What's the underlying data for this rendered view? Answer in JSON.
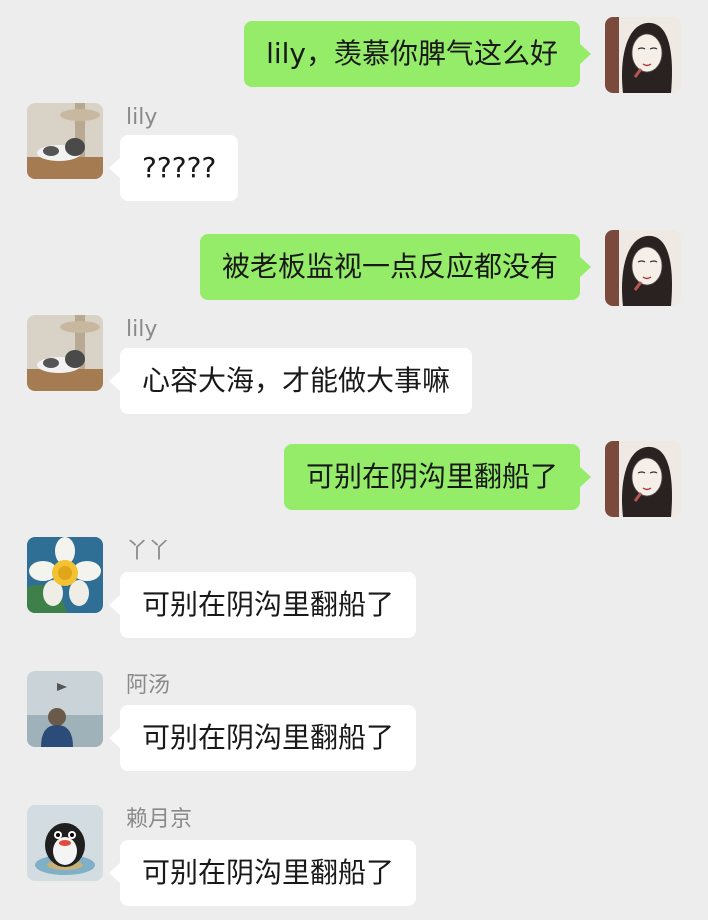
{
  "colors": {
    "background": "#ededed",
    "sent_bubble": "#95ec69",
    "received_bubble": "#ffffff",
    "name_text": "#8a8a8a"
  },
  "messages": [
    {
      "side": "right",
      "avatar": "woman-sketch-avatar",
      "text": "lily，羡慕你脾气这么好"
    },
    {
      "side": "left",
      "sender": "lily",
      "avatar": "cat-avatar",
      "text": "?????"
    },
    {
      "side": "right",
      "avatar": "woman-sketch-avatar",
      "text": "被老板监视一点反应都没有"
    },
    {
      "side": "left",
      "sender": "lily",
      "avatar": "cat-avatar",
      "text": "心容大海，才能做大事嘛"
    },
    {
      "side": "right",
      "avatar": "woman-sketch-avatar",
      "text": "可别在阴沟里翻船了"
    },
    {
      "side": "left",
      "sender": "丫丫",
      "avatar": "daffodil-avatar",
      "text": "可别在阴沟里翻船了"
    },
    {
      "side": "left",
      "sender": "阿汤",
      "avatar": "child-by-sea-avatar",
      "text": "可别在阴沟里翻船了"
    },
    {
      "side": "left",
      "sender": "赖月京",
      "avatar": "penguin-avatar",
      "text": "可别在阴沟里翻船了"
    }
  ]
}
